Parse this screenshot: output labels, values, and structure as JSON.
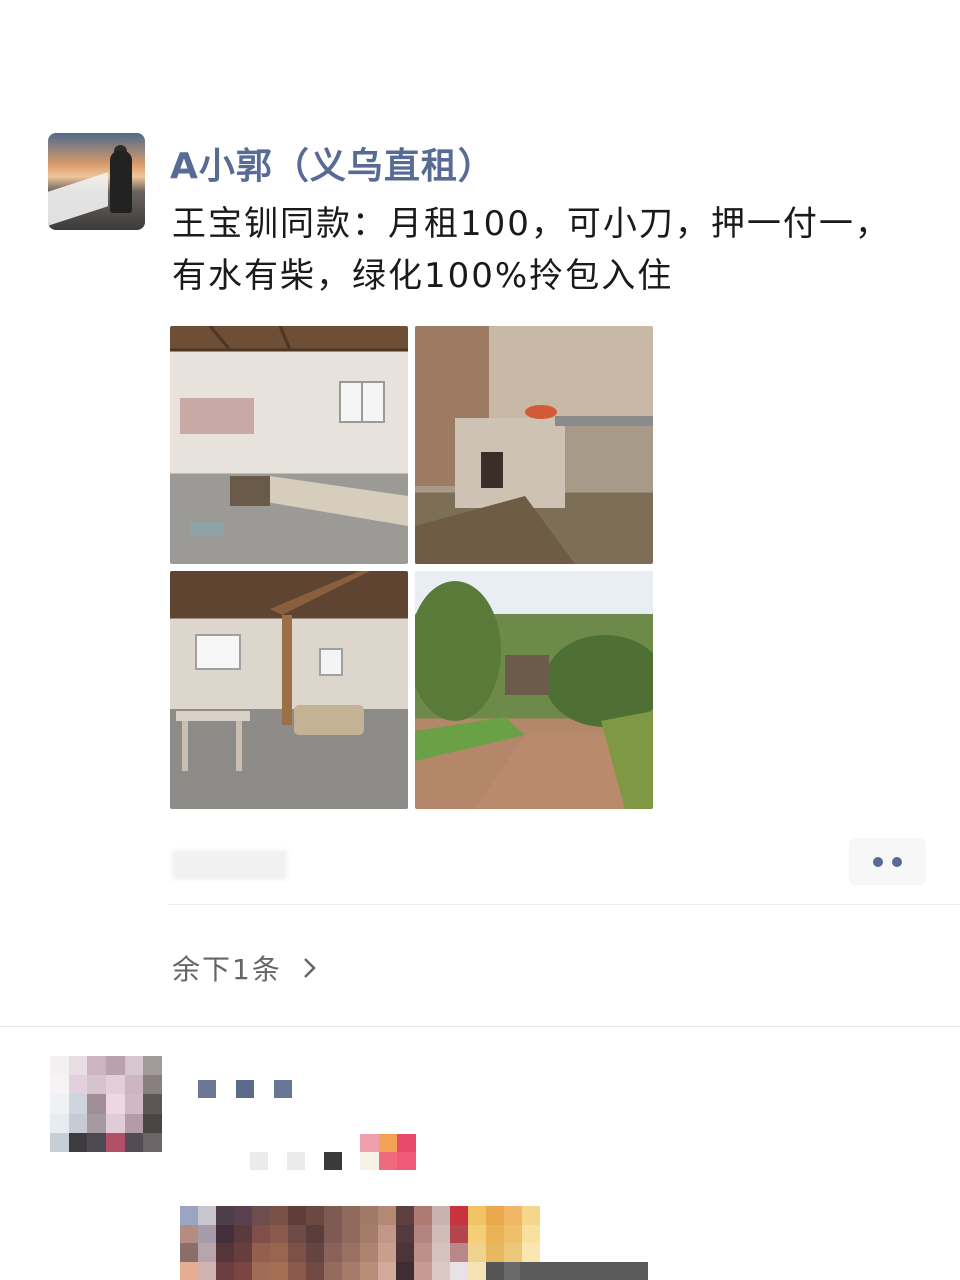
{
  "post": {
    "username": "A小郭（义乌直租）",
    "text": "王宝钏同款：月租100，可小刀，押一付一，有水有柴，绿化100%拎包入住",
    "photos": [
      {
        "name": "bedroom-photo"
      },
      {
        "name": "kitchen-stove-photo"
      },
      {
        "name": "living-room-photo"
      },
      {
        "name": "garden-photo"
      }
    ],
    "more_icon": "more-dots-icon"
  },
  "remaining": {
    "label": "余下1条",
    "icon": "chevron-right-icon"
  },
  "colors": {
    "link": "#576b95",
    "text": "#1a1a1a",
    "muted": "#666666"
  }
}
